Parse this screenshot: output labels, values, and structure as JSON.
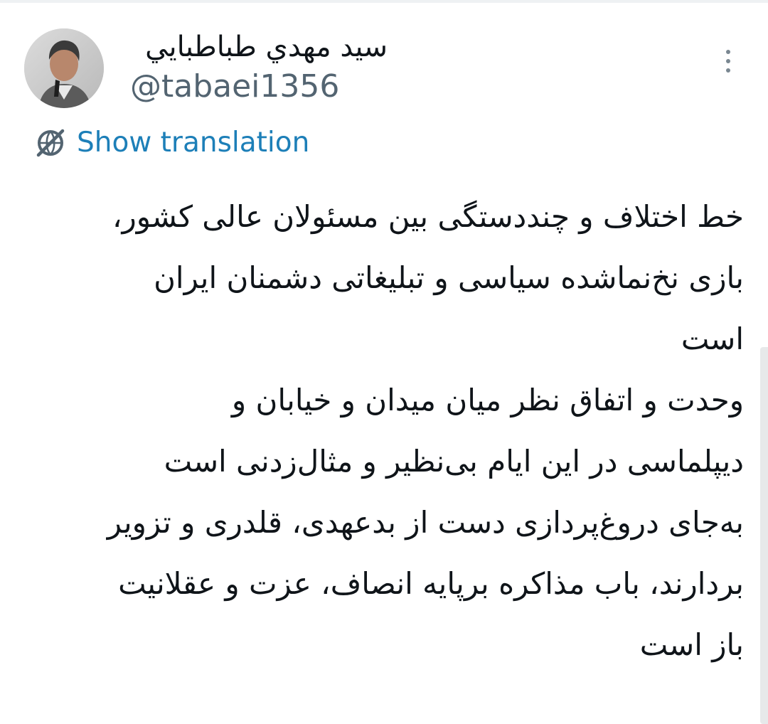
{
  "tweet": {
    "author": {
      "display_name": "سيد مهدي طباطبايي",
      "handle": "@tabaei1356"
    },
    "translate_label": "Show translation",
    "body_lines": [
      "خط اختلاف و چنددستگی بین مسئولان عالی کشور،",
      "بازی نخ‌نماشده سیاسی و تبلیغاتی دشمنان ایران",
      "است",
      "وحدت و اتفاق نظر میان میدان و خیابان و",
      "دیپلماسی در این ایام بی‌نظیر و مثال‌زدنی است",
      "به‌جای دروغ‌پردازی دست از بدعهدی، قلدری و تزویر",
      "بردارند، باب مذاکره برپایه انصاف، عزت و عقلانیت",
      "باز است"
    ]
  },
  "icons": {
    "translate": "globe-off-icon",
    "more": "vertical-dots-icon"
  },
  "colors": {
    "link": "#1d7fb8",
    "handle": "#536471",
    "text": "#0f1419"
  }
}
